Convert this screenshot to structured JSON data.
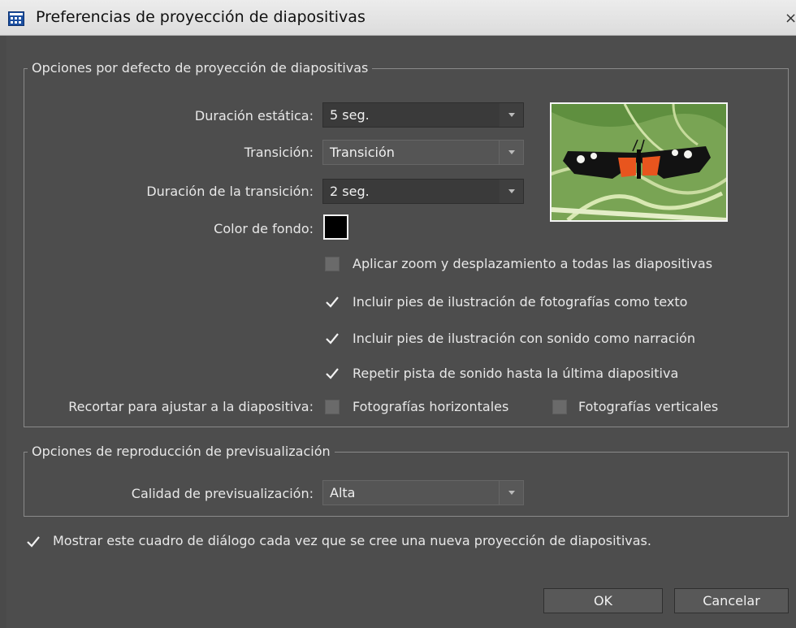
{
  "window": {
    "title": "Preferencias de proyección de diapositivas",
    "close_glyph": "×"
  },
  "defaults_group": {
    "legend": "Opciones por defecto de proyección de diapositivas",
    "static_duration": {
      "label": "Duración estática:",
      "value": "5 seg."
    },
    "transition": {
      "label": "Transición:",
      "value": "Transición"
    },
    "transition_duration": {
      "label": "Duración de la transición:",
      "value": "2 seg."
    },
    "background_color": {
      "label": "Color de fondo:",
      "value": "#000000"
    },
    "checkboxes": [
      {
        "label": "Aplicar zoom y desplazamiento a todas las diapositivas",
        "checked": false
      },
      {
        "label": "Incluir pies de ilustración de fotografías como texto",
        "checked": true
      },
      {
        "label": "Incluir pies de ilustración con sonido como narración",
        "checked": true
      },
      {
        "label": "Repetir pista de sonido hasta la última diapositiva",
        "checked": true
      }
    ],
    "crop": {
      "label": "Recortar para ajustar a la diapositiva:",
      "horizontal": {
        "label": "Fotografías horizontales",
        "checked": false
      },
      "vertical": {
        "label": "Fotografías verticales",
        "checked": false
      }
    },
    "preview_image": "butterfly-photo"
  },
  "preview_group": {
    "legend": "Opciones de reproducción de previsualización",
    "quality": {
      "label": "Calidad de previsualización:",
      "value": "Alta"
    }
  },
  "show_dialog": {
    "label": "Mostrar este cuadro de diálogo cada vez que se cree una nueva proyección de diapositivas.",
    "checked": true
  },
  "buttons": {
    "ok": "OK",
    "cancel": "Cancelar"
  },
  "icons": {
    "app": "slideshow-grid-icon",
    "check": "checkmark-icon",
    "dropdown": "chevron-down-icon"
  }
}
